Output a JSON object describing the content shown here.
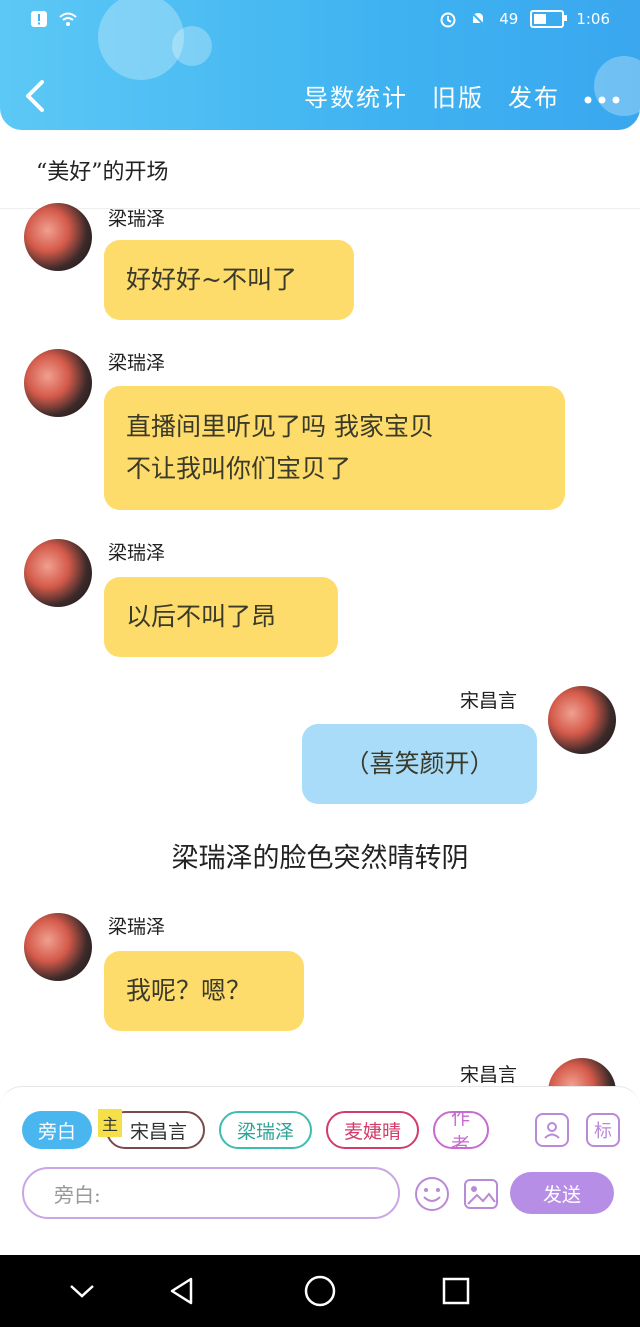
{
  "status_bar": {
    "battery": "49",
    "time": "1:06"
  },
  "header": {
    "actions": [
      "导数统计",
      "旧版",
      "发布"
    ]
  },
  "story_title": "“美好”的开场",
  "messages": [
    {
      "side": "left",
      "name": "梁瑞泽",
      "text": "好好好~不叫了"
    },
    {
      "side": "left",
      "name": "梁瑞泽",
      "text": "直播间里听见了吗 我家宝贝",
      "text2": "不让我叫你们宝贝了"
    },
    {
      "side": "left",
      "name": "梁瑞泽",
      "text": "以后不叫了昂"
    },
    {
      "side": "right",
      "name": "宋昌言",
      "text": "（喜笑颜开）"
    },
    {
      "side": "left",
      "name": "梁瑞泽",
      "text": "我呢？嗯？"
    },
    {
      "side": "right",
      "name": "宋昌言"
    }
  ],
  "narration": "梁瑞泽的脸色突然晴转阴",
  "input_panel": {
    "roles": [
      "旁白",
      "宋昌言",
      "梁瑞泽",
      "麦婕晴",
      "作者"
    ],
    "host_badge": "主",
    "tag_label": "标",
    "placeholder": "旁白:",
    "send_label": "发送"
  },
  "colors": {
    "header": "#3fb3f1",
    "left_bubble": "#fddc6b",
    "right_bubble": "#a9dcf8",
    "send": "#b78ee6"
  }
}
